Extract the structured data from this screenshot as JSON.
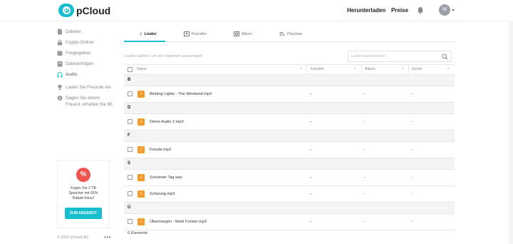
{
  "header": {
    "logo_text": "pCloud",
    "download_label": "Herunterladen",
    "prices_label": "Preise",
    "avatar_initial": "M"
  },
  "sidebar": {
    "items": [
      {
        "label": "Dateien",
        "icon": "file-icon"
      },
      {
        "label": "Crypto-Ordner",
        "icon": "lock-icon"
      },
      {
        "label": "Freigegeben",
        "icon": "share-icon"
      },
      {
        "label": "Dateianfragen",
        "icon": "file-request-icon"
      },
      {
        "label": "Audio",
        "icon": "headphones-icon",
        "active": true
      }
    ],
    "invite_label": "Laden Sie Freunde ein",
    "earn_label": "Sagen Sie einem Freund, erhalten Sie $5"
  },
  "promo": {
    "badge": "%",
    "text": "Fügen Sie 2 TB Speicher mit 65% Rabatt hinzu!",
    "button_label": "ZUM ANGEBOT"
  },
  "footer": {
    "copyright": "© 2020 pCloud AG",
    "more": "•••"
  },
  "tabs": [
    {
      "label": "Lieder",
      "active": true
    },
    {
      "label": "Künstler"
    },
    {
      "label": "Alben"
    },
    {
      "label": "Playlists"
    }
  ],
  "hint": "Lieder wählen, um die Optionen anzuzeigen",
  "search": {
    "placeholder": "Lieder durchsuchen"
  },
  "columns": [
    "Name",
    "Künstler",
    "Album",
    "Genre"
  ],
  "groups": [
    {
      "letter": "B",
      "rows": [
        {
          "name": "Binding Lights - The Weekend.mp3",
          "artist": "-",
          "album": "-",
          "genre": "-"
        }
      ]
    },
    {
      "letter": "D",
      "rows": [
        {
          "name": "Demo Audio 2.mp3",
          "artist": "-",
          "album": "-",
          "genre": "-"
        }
      ]
    },
    {
      "letter": "F",
      "rows": [
        {
          "name": "Freude.mp3",
          "artist": "-",
          "album": "-",
          "genre": "-"
        }
      ]
    },
    {
      "letter": "S",
      "rows": [
        {
          "name": "Schoener Tag.wav",
          "artist": "-",
          "album": "-",
          "genre": "-"
        },
        {
          "name": "Schwung.mp3",
          "artist": "-",
          "album": "-",
          "genre": "-"
        }
      ]
    },
    {
      "letter": "Ü",
      "rows": [
        {
          "name": "Übermorgen - Mark Forster.mp3",
          "artist": "-",
          "album": "-",
          "genre": "-"
        }
      ]
    }
  ],
  "count_label": "6 Elemente",
  "colors": {
    "accent": "#17bed0",
    "file_icon": "#f39c2c",
    "promo_badge": "#ef5350"
  }
}
